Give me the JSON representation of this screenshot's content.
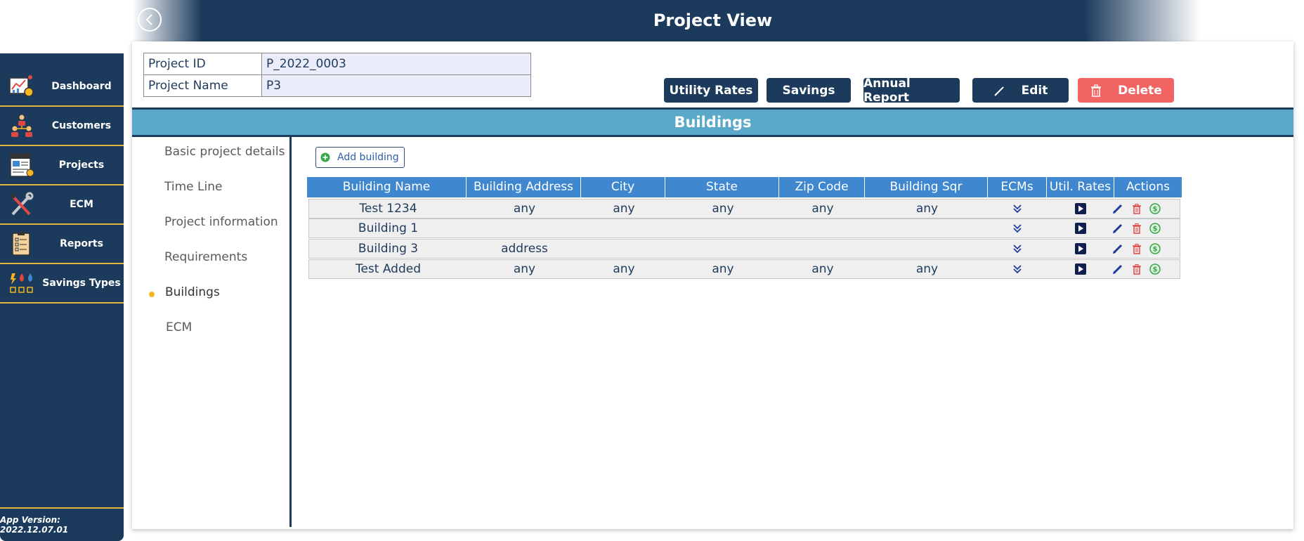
{
  "header": {
    "title": "Project View"
  },
  "sidebar": {
    "items": [
      {
        "label": "Dashboard",
        "icon": "dashboard-chart-icon"
      },
      {
        "label": "Customers",
        "icon": "customers-icon"
      },
      {
        "label": "Projects",
        "icon": "project-document-icon"
      },
      {
        "label": "ECM",
        "icon": "tools-icon"
      },
      {
        "label": "Reports",
        "icon": "clipboard-checklist-icon"
      },
      {
        "label": "Savings Types",
        "icon": "energy-water-icon"
      }
    ],
    "version": "App Version: 2022.12.07.01"
  },
  "project": {
    "id_label": "Project ID",
    "id_value": "P_2022_0003",
    "name_label": "Project Name",
    "name_value": "P3"
  },
  "actions": {
    "utility_rates": "Utility Rates",
    "savings": "Savings",
    "annual_report": "Annual Report",
    "edit": "Edit",
    "delete": "Delete"
  },
  "section": {
    "title": "Buildings"
  },
  "side_nav": {
    "items": [
      "Basic project details",
      "Time Line",
      "Project information",
      "Requirements",
      "Buildings",
      "ECM"
    ],
    "active": "Buildings"
  },
  "buildings": {
    "add_label": "Add building",
    "columns": [
      "Building Name",
      "Building Address",
      "City",
      "State",
      "Zip Code",
      "Building Sqr Footage",
      "ECMs",
      "Util. Rates",
      "Actions"
    ],
    "rows": [
      {
        "name": "Test 1234",
        "address": "any",
        "city": "any",
        "state": "any",
        "zip": "any",
        "sqft": "any"
      },
      {
        "name": "Building 1",
        "address": "",
        "city": "",
        "state": "",
        "zip": "",
        "sqft": ""
      },
      {
        "name": "Building 3",
        "address": "address",
        "city": "",
        "state": "",
        "zip": "",
        "sqft": ""
      },
      {
        "name": "Test Added",
        "address": "any",
        "city": "any",
        "state": "any",
        "zip": "any",
        "sqft": "any"
      }
    ]
  },
  "colors": {
    "navy": "#1b3a5c",
    "accent_gold": "#e0b43a",
    "section_blue": "#5aa9c8",
    "table_header": "#3f88cf",
    "delete_red": "#f26464"
  }
}
